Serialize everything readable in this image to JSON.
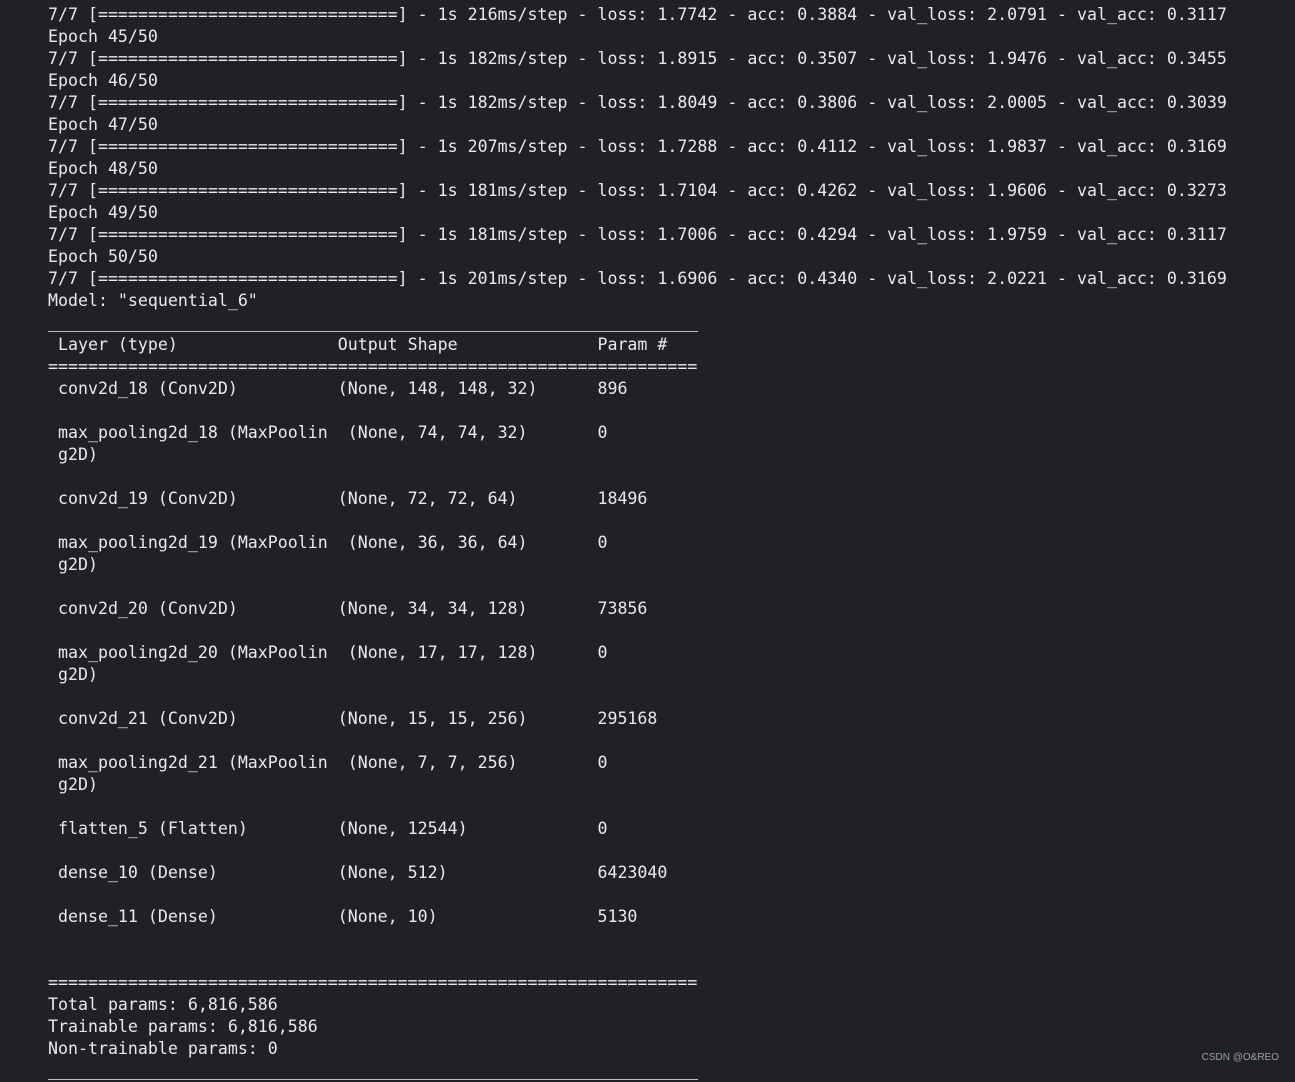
{
  "log": {
    "lines": [
      "7/7 [==============================] - 1s 216ms/step - loss: 1.7742 - acc: 0.3884 - val_loss: 2.0791 - val_acc: 0.3117",
      "Epoch 45/50",
      "7/7 [==============================] - 1s 182ms/step - loss: 1.8915 - acc: 0.3507 - val_loss: 1.9476 - val_acc: 0.3455",
      "Epoch 46/50",
      "7/7 [==============================] - 1s 182ms/step - loss: 1.8049 - acc: 0.3806 - val_loss: 2.0005 - val_acc: 0.3039",
      "Epoch 47/50",
      "7/7 [==============================] - 1s 207ms/step - loss: 1.7288 - acc: 0.4112 - val_loss: 1.9837 - val_acc: 0.3169",
      "Epoch 48/50",
      "7/7 [==============================] - 1s 181ms/step - loss: 1.7104 - acc: 0.4262 - val_loss: 1.9606 - val_acc: 0.3273",
      "Epoch 49/50",
      "7/7 [==============================] - 1s 181ms/step - loss: 1.7006 - acc: 0.4294 - val_loss: 1.9759 - val_acc: 0.3117",
      "Epoch 50/50",
      "7/7 [==============================] - 1s 201ms/step - loss: 1.6906 - acc: 0.4340 - val_loss: 2.0221 - val_acc: 0.3169"
    ]
  },
  "summary": {
    "model_line": "Model: \"sequential_6\"",
    "header": " Layer (type)                Output Shape              Param #   ",
    "double_rule": "=================================================================",
    "rows": [
      " conv2d_18 (Conv2D)          (None, 148, 148, 32)      896       ",
      "",
      " max_pooling2d_18 (MaxPoolin  (None, 74, 74, 32)       0         ",
      " g2D)                                                            ",
      "",
      " conv2d_19 (Conv2D)          (None, 72, 72, 64)        18496     ",
      "",
      " max_pooling2d_19 (MaxPoolin  (None, 36, 36, 64)       0         ",
      " g2D)                                                            ",
      "",
      " conv2d_20 (Conv2D)          (None, 34, 34, 128)       73856     ",
      "",
      " max_pooling2d_20 (MaxPoolin  (None, 17, 17, 128)      0         ",
      " g2D)                                                            ",
      "",
      " conv2d_21 (Conv2D)          (None, 15, 15, 256)       295168    ",
      "",
      " max_pooling2d_21 (MaxPoolin  (None, 7, 7, 256)        0         ",
      " g2D)                                                            ",
      "",
      " flatten_5 (Flatten)         (None, 12544)             0         ",
      "",
      " dense_10 (Dense)            (None, 512)               6423040   ",
      "",
      " dense_11 (Dense)            (None, 10)                5130      ",
      "",
      ""
    ],
    "total_params": "Total params: 6,816,586",
    "trainable_params": "Trainable params: 6,816,586",
    "non_trainable_params": "Non-trainable params: 0"
  },
  "watermark": "CSDN @O&REO",
  "colors": {
    "background": "#202124",
    "text": "#e8eaed"
  }
}
